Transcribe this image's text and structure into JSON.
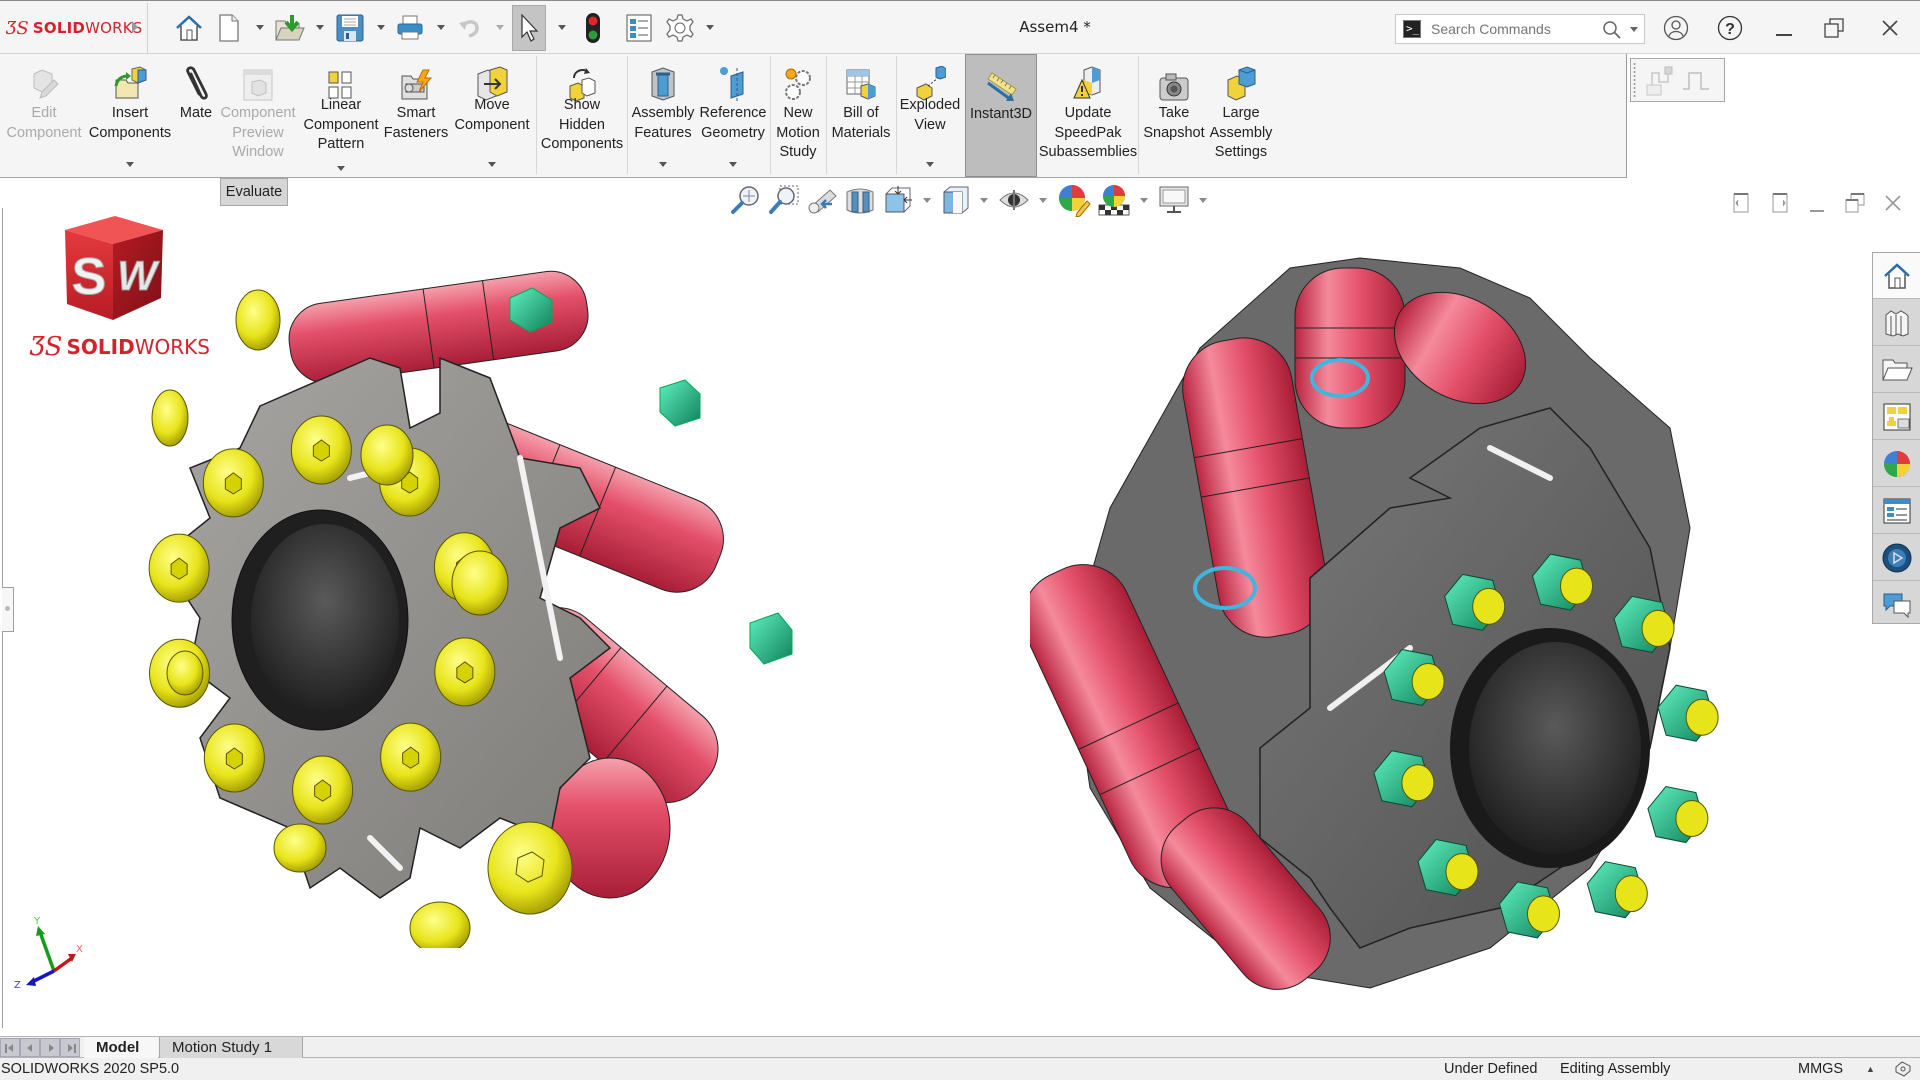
{
  "app": {
    "brand_bold": "SOLID",
    "brand_light": "WORKS",
    "document_title": "Assem4 *"
  },
  "quick_access": {
    "items": [
      {
        "name": "home",
        "icon": "home-icon",
        "has_dropdown": false
      },
      {
        "name": "new",
        "icon": "new-document-icon",
        "has_dropdown": true
      },
      {
        "name": "open",
        "icon": "open-folder-icon",
        "has_dropdown": true
      },
      {
        "name": "save",
        "icon": "save-icon",
        "has_dropdown": true
      },
      {
        "name": "print",
        "icon": "print-icon",
        "has_dropdown": true
      },
      {
        "name": "undo",
        "icon": "undo-icon",
        "has_dropdown": true,
        "disabled": true
      },
      {
        "name": "select",
        "icon": "select-arrow-icon",
        "has_dropdown": true,
        "active": true
      },
      {
        "name": "rebuild",
        "icon": "traffic-light-icon",
        "has_dropdown": false
      },
      {
        "name": "file-properties",
        "icon": "file-properties-icon",
        "has_dropdown": false
      },
      {
        "name": "options",
        "icon": "gear-icon",
        "has_dropdown": true
      }
    ]
  },
  "search": {
    "placeholder": "Search Commands"
  },
  "command_manager": {
    "buttons": [
      {
        "id": "edit-component",
        "label": "Edit\nComponent",
        "disabled": true,
        "dropdown": false
      },
      {
        "id": "insert-components",
        "label": "Insert\nComponents",
        "disabled": false,
        "dropdown": true
      },
      {
        "id": "mate",
        "label": "Mate",
        "disabled": false,
        "dropdown": false
      },
      {
        "id": "component-preview-window",
        "label": "Component\nPreview\nWindow",
        "disabled": true,
        "dropdown": false
      },
      {
        "id": "linear-component-pattern",
        "label": "Linear\nComponent\nPattern",
        "disabled": false,
        "dropdown": true
      },
      {
        "id": "smart-fasteners",
        "label": "Smart\nFasteners",
        "disabled": false,
        "dropdown": false
      },
      {
        "id": "move-component",
        "label": "Move\nComponent",
        "disabled": false,
        "dropdown": true
      },
      {
        "id": "show-hidden-components",
        "label": "Show\nHidden\nComponents",
        "disabled": false,
        "dropdown": false
      },
      {
        "id": "assembly-features",
        "label": "Assembly\nFeatures",
        "disabled": false,
        "dropdown": true
      },
      {
        "id": "reference-geometry",
        "label": "Reference\nGeometry",
        "disabled": false,
        "dropdown": true
      },
      {
        "id": "new-motion-study",
        "label": "New\nMotion\nStudy",
        "disabled": false,
        "dropdown": false
      },
      {
        "id": "bill-of-materials",
        "label": "Bill of\nMaterials",
        "disabled": false,
        "dropdown": false
      },
      {
        "id": "exploded-view",
        "label": "Exploded\nView",
        "disabled": false,
        "dropdown": true
      },
      {
        "id": "instant3d",
        "label": "Instant3D",
        "disabled": false,
        "dropdown": false,
        "active": true
      },
      {
        "id": "update-speedpak",
        "label": "Update\nSpeedPak\nSubassemblies",
        "disabled": false,
        "dropdown": false
      },
      {
        "id": "take-snapshot",
        "label": "Take\nSnapshot",
        "disabled": false,
        "dropdown": false
      },
      {
        "id": "large-assembly-settings",
        "label": "Large\nAssembly\nSettings",
        "disabled": false,
        "dropdown": false
      }
    ]
  },
  "viewport": {
    "evaluate_tab": "Evaluate",
    "splash_brand_bold": "SOLID",
    "splash_brand_light": "WORKS",
    "splash_cube_letters": "SW",
    "triad": {
      "x": "X",
      "y": "Y",
      "z": "Z"
    },
    "heads_up_toolbar": [
      {
        "name": "zoom-to-fit",
        "icon": "zoom-to-fit-icon",
        "dropdown": false
      },
      {
        "name": "zoom-to-area",
        "icon": "zoom-to-area-icon",
        "dropdown": false
      },
      {
        "name": "previous-view",
        "icon": "previous-view-icon",
        "dropdown": false
      },
      {
        "name": "section-view",
        "icon": "section-view-icon",
        "dropdown": false
      },
      {
        "name": "view-orientation",
        "icon": "view-orientation-icon",
        "dropdown": true
      },
      {
        "name": "display-style",
        "icon": "display-style-icon",
        "dropdown": true
      },
      {
        "name": "hide-show-items",
        "icon": "eye-icon",
        "dropdown": true
      },
      {
        "name": "edit-appearance",
        "icon": "edit-appearance-icon",
        "dropdown": false
      },
      {
        "name": "apply-scene",
        "icon": "apply-scene-icon",
        "dropdown": true
      },
      {
        "name": "view-settings",
        "icon": "monitor-icon",
        "dropdown": true
      }
    ],
    "task_pane_tabs": [
      {
        "name": "solidworks-resources",
        "icon": "home-icon",
        "selected": true
      },
      {
        "name": "design-library",
        "icon": "design-library-icon",
        "selected": false
      },
      {
        "name": "file-explorer",
        "icon": "folder-icon",
        "selected": false
      },
      {
        "name": "view-palette",
        "icon": "view-palette-icon",
        "selected": false
      },
      {
        "name": "appearances-scenes",
        "icon": "appearances-icon",
        "selected": false
      },
      {
        "name": "custom-properties",
        "icon": "custom-properties-icon",
        "selected": false
      },
      {
        "name": "solidworks-forum",
        "icon": "forum-icon",
        "selected": false
      },
      {
        "name": "3dexperience",
        "icon": "chat-icon",
        "selected": false
      }
    ],
    "model_colors": {
      "roller": "#e0485e",
      "plate": "#8d8d8d",
      "screw": "#e8e41a",
      "nut": "#2fd8a8",
      "bearing": "#3fb5e0"
    }
  },
  "bottom_tabs": {
    "tabs": [
      {
        "label": "Model",
        "active": true
      },
      {
        "label": "Motion Study 1",
        "active": false
      }
    ]
  },
  "status_bar": {
    "version": "SOLIDWORKS 2020 SP5.0",
    "definition_state": "Under Defined",
    "mode": "Editing Assembly",
    "units": "MMGS",
    "units_arrow": "▲"
  }
}
